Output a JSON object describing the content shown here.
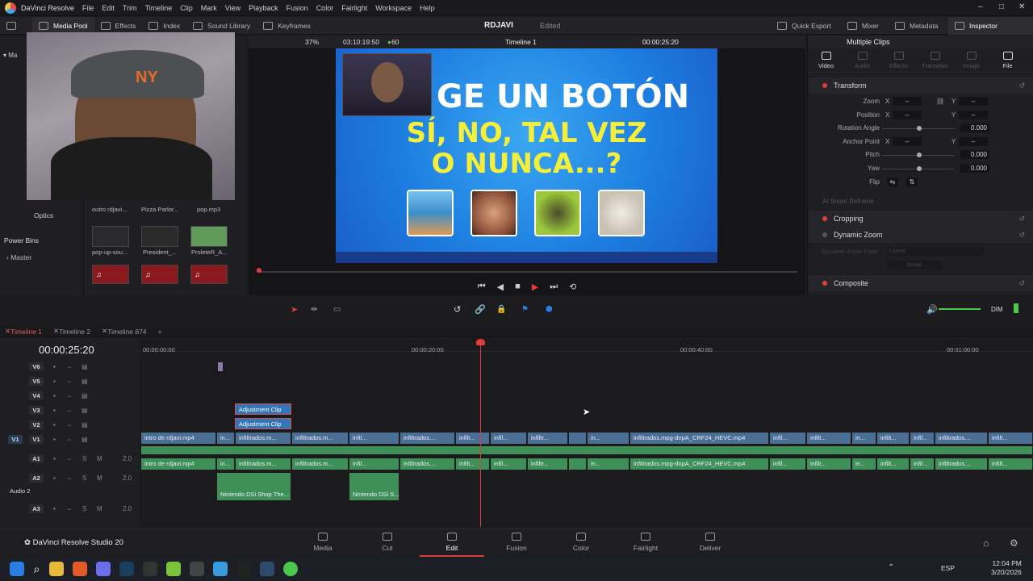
{
  "menubar": {
    "app_title": "DaVinci Resolve",
    "items": [
      "File",
      "Edit",
      "Trim",
      "Timeline",
      "Clip",
      "Mark",
      "View",
      "Playback",
      "Fusion",
      "Color",
      "Fairlight",
      "Workspace",
      "Help"
    ]
  },
  "toolbar": {
    "left": [
      "Media Pool",
      "Effects",
      "Index",
      "Sound Library",
      "Keyframes"
    ],
    "project_name": "RDJAVI",
    "project_status": "Edited",
    "right": [
      "Quick Export",
      "Mixer",
      "Metadata",
      "Inspector"
    ]
  },
  "viewer": {
    "zoom": "37%",
    "source_tc": "03:10:19:50",
    "fps": "60",
    "timeline_name": "Timeline 1",
    "record_tc": "00:00:25:20",
    "title_line1": "GE UN BOTÓN",
    "title_line2": "SÍ, NO, TAL VEZ",
    "title_line3": "O NUNCA...?"
  },
  "media_pool": {
    "clips": [
      {
        "name": "outro rdjavi..."
      },
      {
        "name": "Pizza Parlor..."
      },
      {
        "name": "pop.mp3"
      },
      {
        "name": "pop-up-sou..."
      },
      {
        "name": "President_..."
      },
      {
        "name": "ProleteR_A..."
      }
    ],
    "left_labels": [
      "Optics"
    ],
    "power_bins": "Power Bins",
    "master": "Master"
  },
  "inspector": {
    "header": "Multiple Clips",
    "tabs": [
      "Video",
      "Audio",
      "Effects",
      "Transition",
      "Image",
      "File"
    ],
    "transform": "Transform",
    "rows": [
      {
        "label": "Zoom",
        "x": "--",
        "y": "--"
      },
      {
        "label": "Position",
        "x": "--",
        "y": "--"
      },
      {
        "label": "Rotation Angle",
        "value": "0.000"
      },
      {
        "label": "Anchor Point",
        "x": "--",
        "y": "--"
      },
      {
        "label": "Pitch",
        "value": "0.000"
      },
      {
        "label": "Yaw",
        "value": "0.000"
      },
      {
        "label": "Flip"
      }
    ],
    "ai_reframe": "AI Smart Reframe",
    "cropping": "Cropping",
    "dynamic_zoom": "Dynamic Zoom",
    "dz_ease": "Dynamic Zoom Ease",
    "dz_ease_value": "Linear",
    "swap": "Swap",
    "composite": "Composite",
    "axis_x": "X",
    "axis_y": "Y"
  },
  "timeline": {
    "tabs": [
      "Timeline 1",
      "Timeline 2",
      "Timeline 874"
    ],
    "timecode": "00:00:25:20",
    "ruler": [
      "00:00:00:00",
      "00:00:20:00",
      "00:00:40:00",
      "00:01:00:00"
    ],
    "video_tracks": [
      "V6",
      "V5",
      "V4",
      "V3",
      "V2",
      "V1"
    ],
    "audio_tracks": [
      {
        "name": "A1",
        "level": "2.0"
      },
      {
        "name": "A2",
        "level": "2.0",
        "label": "Audio 2"
      },
      {
        "name": "A3",
        "level": "2.0"
      }
    ],
    "audio_track_label": "Audio 2",
    "src_v1": "V1",
    "adjustment_clip": "Adjustment Clip",
    "clip_intro": "intro de rdjavi.mp4",
    "clip_infil": "infiltrados.m...",
    "clip_long": "infiltrados.mpg-dnpA_CRF24_HEVC.mp4",
    "clip_nintendo1": "Nintendo DSi Shop The...",
    "clip_nintendo2": "Nintendo DSi S...",
    "audio_level_label": "DIM"
  },
  "pages": [
    "Media",
    "Cut",
    "Edit",
    "Fusion",
    "Color",
    "Fairlight",
    "Deliver"
  ],
  "footer": {
    "product": "DaVinci Resolve Studio 20"
  },
  "taskbar": {
    "lang": "ESP",
    "time": "12:04 PM",
    "date": "3/20/2026"
  }
}
